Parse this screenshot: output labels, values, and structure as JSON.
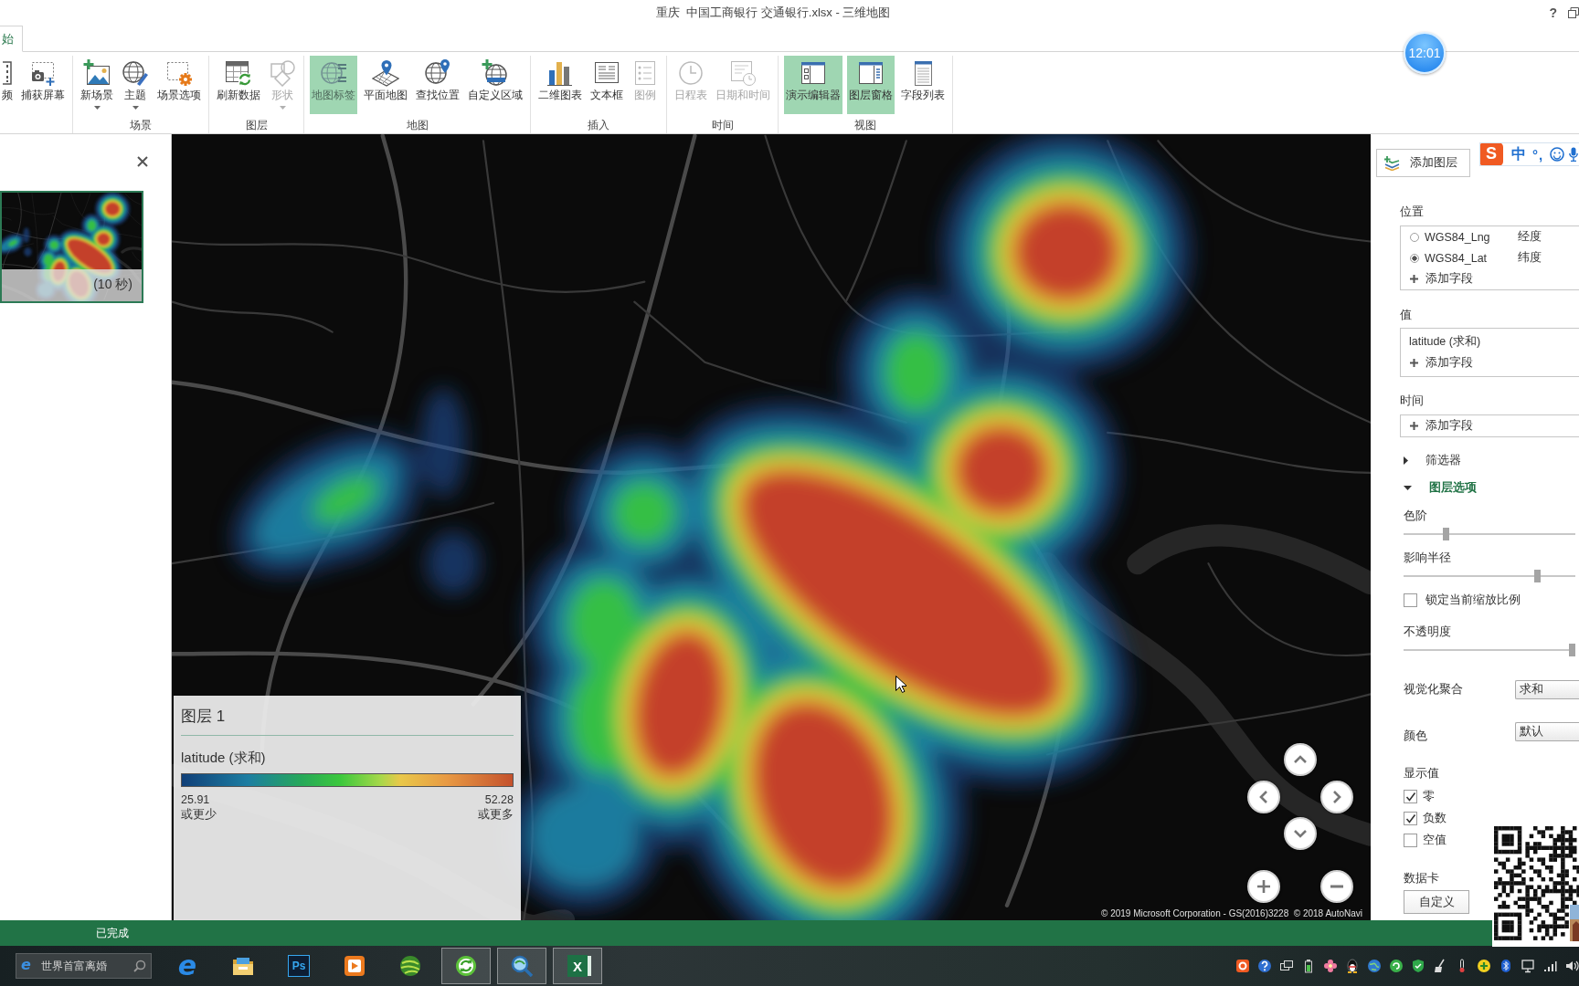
{
  "window": {
    "title": "重庆  中国工商银行 交通银行.xlsx - 三维地图",
    "help": "?"
  },
  "tabs": [
    {
      "label": "始",
      "selected": true
    }
  ],
  "clock": "12:01",
  "ribbon": {
    "groups": [
      {
        "buttons": [
          {
            "label": "频",
            "on": false,
            "disabled": false,
            "dropdown": false
          },
          {
            "label": "捕获屏幕",
            "on": false,
            "disabled": false,
            "dropdown": false
          }
        ]
      },
      {
        "label": "场景",
        "buttons": [
          {
            "label": "新场景",
            "on": false,
            "disabled": false,
            "dropdown": true
          },
          {
            "label": "主题",
            "on": false,
            "disabled": false,
            "dropdown": true
          },
          {
            "label": "场景选项",
            "on": false,
            "disabled": false,
            "dropdown": false
          }
        ]
      },
      {
        "label": "图层",
        "buttons": [
          {
            "label": "刷新数据",
            "on": false,
            "disabled": false,
            "dropdown": false
          },
          {
            "label": "形状",
            "on": false,
            "disabled": true,
            "dropdown": true
          }
        ]
      },
      {
        "label": "地图",
        "buttons": [
          {
            "label": "地图标签",
            "on": true,
            "disabled": true,
            "dropdown": false
          },
          {
            "label": "平面地图",
            "on": false,
            "disabled": false,
            "dropdown": false
          },
          {
            "label": "查找位置",
            "on": false,
            "disabled": false,
            "dropdown": false
          },
          {
            "label": "自定义区域",
            "on": false,
            "disabled": false,
            "dropdown": false
          }
        ]
      },
      {
        "label": "插入",
        "buttons": [
          {
            "label": "二维图表",
            "on": false,
            "disabled": false,
            "dropdown": false
          },
          {
            "label": "文本框",
            "on": false,
            "disabled": false,
            "dropdown": false
          },
          {
            "label": "图例",
            "on": false,
            "disabled": true,
            "dropdown": false
          }
        ]
      },
      {
        "label": "时间",
        "buttons": [
          {
            "label": "日程表",
            "on": false,
            "disabled": true,
            "dropdown": false
          },
          {
            "label": "日期和时间",
            "on": false,
            "disabled": true,
            "dropdown": false
          }
        ]
      },
      {
        "label": "视图",
        "buttons": [
          {
            "label": "演示编辑器",
            "on": true,
            "disabled": false,
            "dropdown": false
          },
          {
            "label": "图层窗格",
            "on": true,
            "disabled": false,
            "dropdown": false
          },
          {
            "label": "字段列表",
            "on": false,
            "disabled": false,
            "dropdown": false
          }
        ]
      }
    ]
  },
  "tour_panel": {
    "scenes": [
      {
        "duration": "(10 秒)",
        "selected": true
      }
    ]
  },
  "map": {
    "legend": {
      "title": "图层 1",
      "field": "latitude (求和)",
      "min": "25.91",
      "min_note": "或更少",
      "max": "52.28",
      "max_note": "或更多"
    },
    "copyright": "© 2019 Microsoft Corporation - GS(2016)3228  © 2018 AutoNavi"
  },
  "layer_pane": {
    "add_layer": "添加图层",
    "location": {
      "label": "位置",
      "fields": [
        {
          "name": "WGS84_Lng",
          "role": "经度",
          "selected": false
        },
        {
          "name": "WGS84_Lat",
          "role": "纬度",
          "selected": true
        }
      ],
      "add_field": "添加字段"
    },
    "value": {
      "label": "值",
      "fields": [
        "latitude (求和)"
      ],
      "add_field": "添加字段"
    },
    "time": {
      "label": "时间",
      "add_field": "添加字段"
    },
    "filters": {
      "label": "筛选器",
      "expanded": false
    },
    "layer_options": {
      "label": "图层选项",
      "expanded": true,
      "controls": [
        {
          "kind": "slider",
          "label": "色阶",
          "level": 0.24
        },
        {
          "kind": "slider",
          "label": "影响半径",
          "level": 0.79
        },
        {
          "kind": "checkbox",
          "label": "锁定当前缩放比例",
          "checked": false
        },
        {
          "kind": "slider",
          "label": "不透明度",
          "level": 1
        },
        {
          "kind": "dropdown",
          "label": "视觉化聚合",
          "value": "求和"
        },
        {
          "kind": "dropdown",
          "label": "颜色",
          "value": "默认"
        },
        {
          "kind": "checklist",
          "label": "显示值",
          "options": [
            {
              "label": "零",
              "checked": true
            },
            {
              "label": "负数",
              "checked": true
            },
            {
              "label": "空值",
              "checked": false
            }
          ]
        },
        {
          "kind": "button",
          "label": "数据卡",
          "button": "自定义"
        }
      ]
    }
  },
  "ime_toolbar": {
    "logo": "S",
    "mode": "中",
    "punctuation": "°,"
  },
  "status_bar": {
    "text": "已完成"
  },
  "taskbar": {
    "search": {
      "logo": "e",
      "placeholder": "世界首富离婚"
    },
    "apps": [
      {
        "kind": "logo",
        "label": "e",
        "active": false
      },
      {
        "kind": "icon",
        "active": false
      },
      {
        "kind": "logo",
        "label": "Ps",
        "active": false
      },
      {
        "kind": "icon",
        "active": false
      },
      {
        "kind": "icon",
        "active": false
      },
      {
        "kind": "icon",
        "active": true
      },
      {
        "kind": "icon",
        "active": true
      },
      {
        "kind": "logo",
        "label": "X",
        "active": true
      }
    ]
  }
}
